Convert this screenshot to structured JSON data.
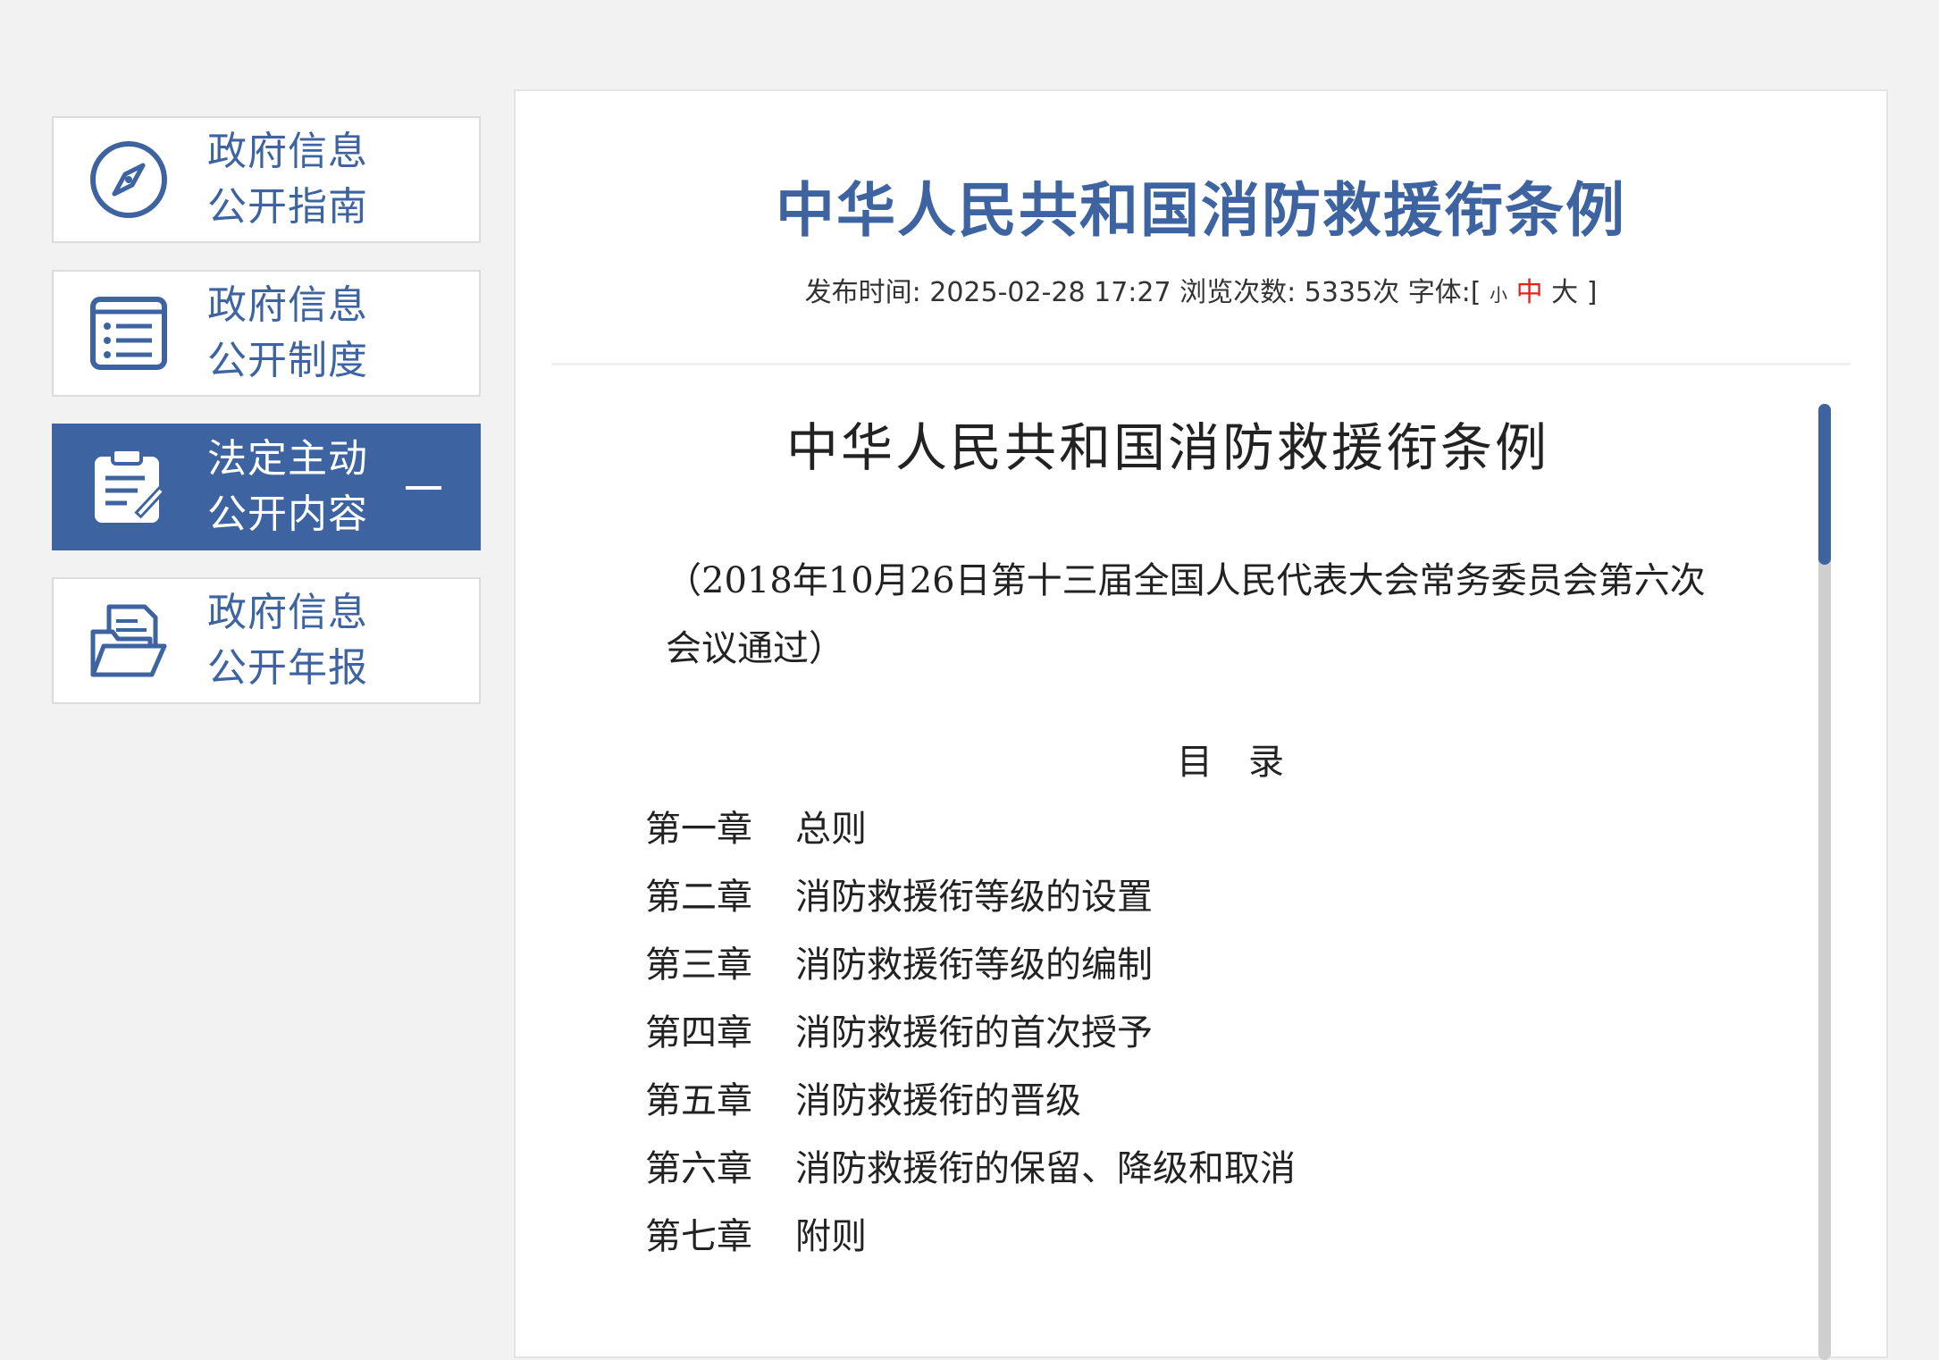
{
  "sidebar": {
    "items": [
      {
        "line1": "政府信息",
        "line2": "公开指南",
        "icon": "compass-icon",
        "active": false
      },
      {
        "line1": "政府信息",
        "line2": "公开制度",
        "icon": "list-icon",
        "active": false
      },
      {
        "line1": "法定主动",
        "line2": "公开内容",
        "icon": "clipboard-edit-icon",
        "active": true,
        "collapse": "—"
      },
      {
        "line1": "政府信息",
        "line2": "公开年报",
        "icon": "folder-document-icon",
        "active": false
      }
    ]
  },
  "article": {
    "title": "中华人民共和国消防救援衔条例",
    "meta": {
      "published_label": "发布时间:",
      "published": "2025-02-28 17:27",
      "views_label": "浏览次数:",
      "views": "5335次",
      "font_label": "字体:[",
      "font_small": "小",
      "font_mid": "中",
      "font_big": "大",
      "font_close": "]"
    }
  },
  "document": {
    "heading": "中华人民共和国消防救援衔条例",
    "note": "（2018年10月26日第十三届全国人民代表大会常务委员会第六次会议通过）",
    "toc_title": "目　录",
    "toc": [
      {
        "chapter": "第一章",
        "name": "总则"
      },
      {
        "chapter": "第二章",
        "name": "消防救援衔等级的设置"
      },
      {
        "chapter": "第三章",
        "name": "消防救援衔等级的编制"
      },
      {
        "chapter": "第四章",
        "name": "消防救援衔的首次授予"
      },
      {
        "chapter": "第五章",
        "name": "消防救援衔的晋级"
      },
      {
        "chapter": "第六章",
        "name": "消防救援衔的保留、降级和取消"
      },
      {
        "chapter": "第七章",
        "name": "附则"
      }
    ]
  },
  "colors": {
    "accent": "#3d64a1",
    "highlight": "#e1251b",
    "background": "#f2f2f2"
  }
}
